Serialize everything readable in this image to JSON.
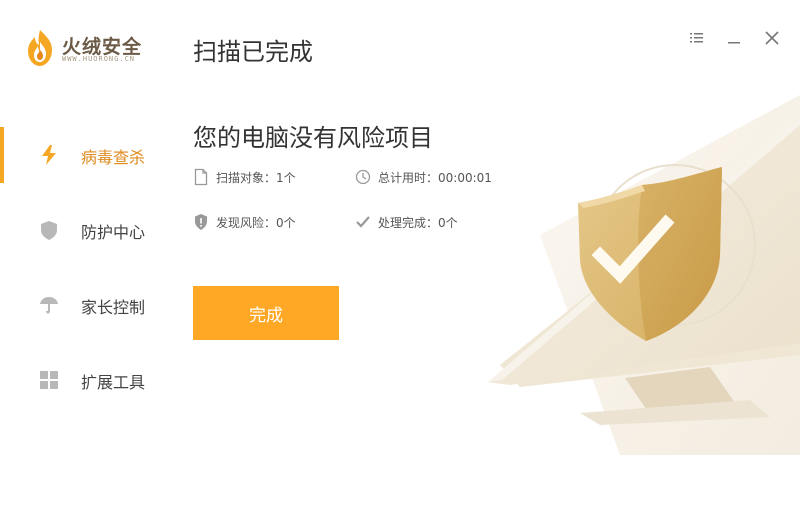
{
  "app": {
    "name": "火绒安全",
    "url": "WWW.HUORONG.CN"
  },
  "header": {
    "title": "扫描已完成"
  },
  "window_controls": {
    "menu_icon": "menu-icon",
    "minimize_icon": "minimize-icon",
    "close_icon": "close-icon"
  },
  "sidebar": {
    "items": [
      {
        "label": "病毒查杀",
        "icon": "lightning-icon",
        "active": true
      },
      {
        "label": "防护中心",
        "icon": "shield-icon",
        "active": false
      },
      {
        "label": "家长控制",
        "icon": "umbrella-icon",
        "active": false
      },
      {
        "label": "扩展工具",
        "icon": "grid-icon",
        "active": false
      }
    ]
  },
  "result": {
    "headline": "您的电脑没有风险项目",
    "stats": {
      "scanned": "扫描对象：1个",
      "elapsed": "总计用时：00:00:01",
      "risks": "发现风险：0个",
      "handled": "处理完成：0个"
    },
    "done_button": "完成"
  },
  "colors": {
    "accent": "#ffa826",
    "active_text": "#e08a1e",
    "shield": "#d9b56a"
  }
}
